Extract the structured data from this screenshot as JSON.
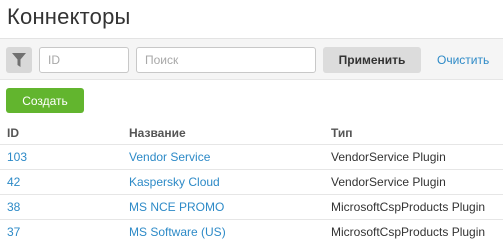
{
  "page": {
    "title": "Коннекторы"
  },
  "filter": {
    "id_placeholder": "ID",
    "search_placeholder": "Поиск",
    "apply_label": "Применить",
    "clear_label": "Очистить"
  },
  "actions": {
    "create_label": "Создать"
  },
  "table": {
    "headers": [
      "ID",
      "Название",
      "Тип"
    ],
    "rows": [
      {
        "id": "103",
        "name": "Vendor Service",
        "type": "VendorService Plugin"
      },
      {
        "id": "42",
        "name": "Kaspersky Cloud",
        "type": "VendorService Plugin"
      },
      {
        "id": "38",
        "name": "MS NCE PROMO",
        "type": "MicrosoftCspProducts Plugin"
      },
      {
        "id": "37",
        "name": "MS Software (US)",
        "type": "MicrosoftCspProducts Plugin"
      }
    ]
  },
  "colors": {
    "link": "#2d8ac7",
    "create_button": "#62b52e",
    "filter_bar": "#f5f5f5"
  },
  "icons": {
    "filter": "funnel-icon"
  }
}
